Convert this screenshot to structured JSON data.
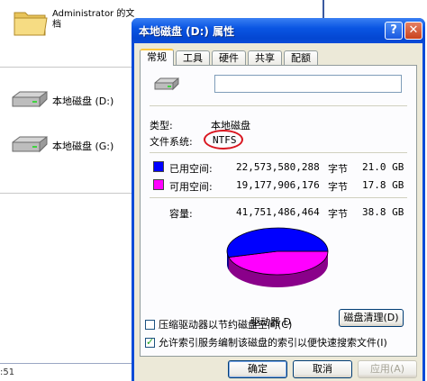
{
  "background": {
    "folder_label": "Administrator 的文档",
    "drives": [
      {
        "label": "本地磁盘 (D:)"
      },
      {
        "label": "本地磁盘 (G:)"
      }
    ],
    "time_fragment": ":51"
  },
  "dialog": {
    "title": "本地磁盘 (D:) 属性",
    "help_button": "?",
    "close_button": "✕",
    "tabs": [
      {
        "label": "常规",
        "active": true
      },
      {
        "label": "工具",
        "active": false
      },
      {
        "label": "硬件",
        "active": false
      },
      {
        "label": "共享",
        "active": false
      },
      {
        "label": "配额",
        "active": false
      }
    ],
    "volume_label_value": "",
    "type_label": "类型:",
    "type_value": "本地磁盘",
    "fs_label": "文件系统:",
    "fs_value": "NTFS",
    "used": {
      "label": "已用空间:",
      "bytes": "22,573,580,288",
      "unit": "字节",
      "size": "21.0 GB",
      "color": "#0000ff"
    },
    "free": {
      "label": "可用空间:",
      "bytes": "19,177,906,176",
      "unit": "字节",
      "size": "17.8 GB",
      "color": "#ff00ff"
    },
    "capacity": {
      "label": "容量:",
      "bytes": "41,751,486,464",
      "unit": "字节",
      "size": "38.8 GB"
    },
    "drive_caption": "驱动器 D",
    "used_fraction": 0.5407,
    "cleanup_button": "磁盘清理(D)",
    "compress_option": {
      "label": "压缩驱动器以节约磁盘空间(C)",
      "checked": false
    },
    "index_option": {
      "label": "允许索引服务编制该磁盘的索引以便快速搜索文件(I)",
      "checked": true
    },
    "buttons": {
      "ok": "确定",
      "cancel": "取消",
      "apply": "应用(A)"
    }
  }
}
